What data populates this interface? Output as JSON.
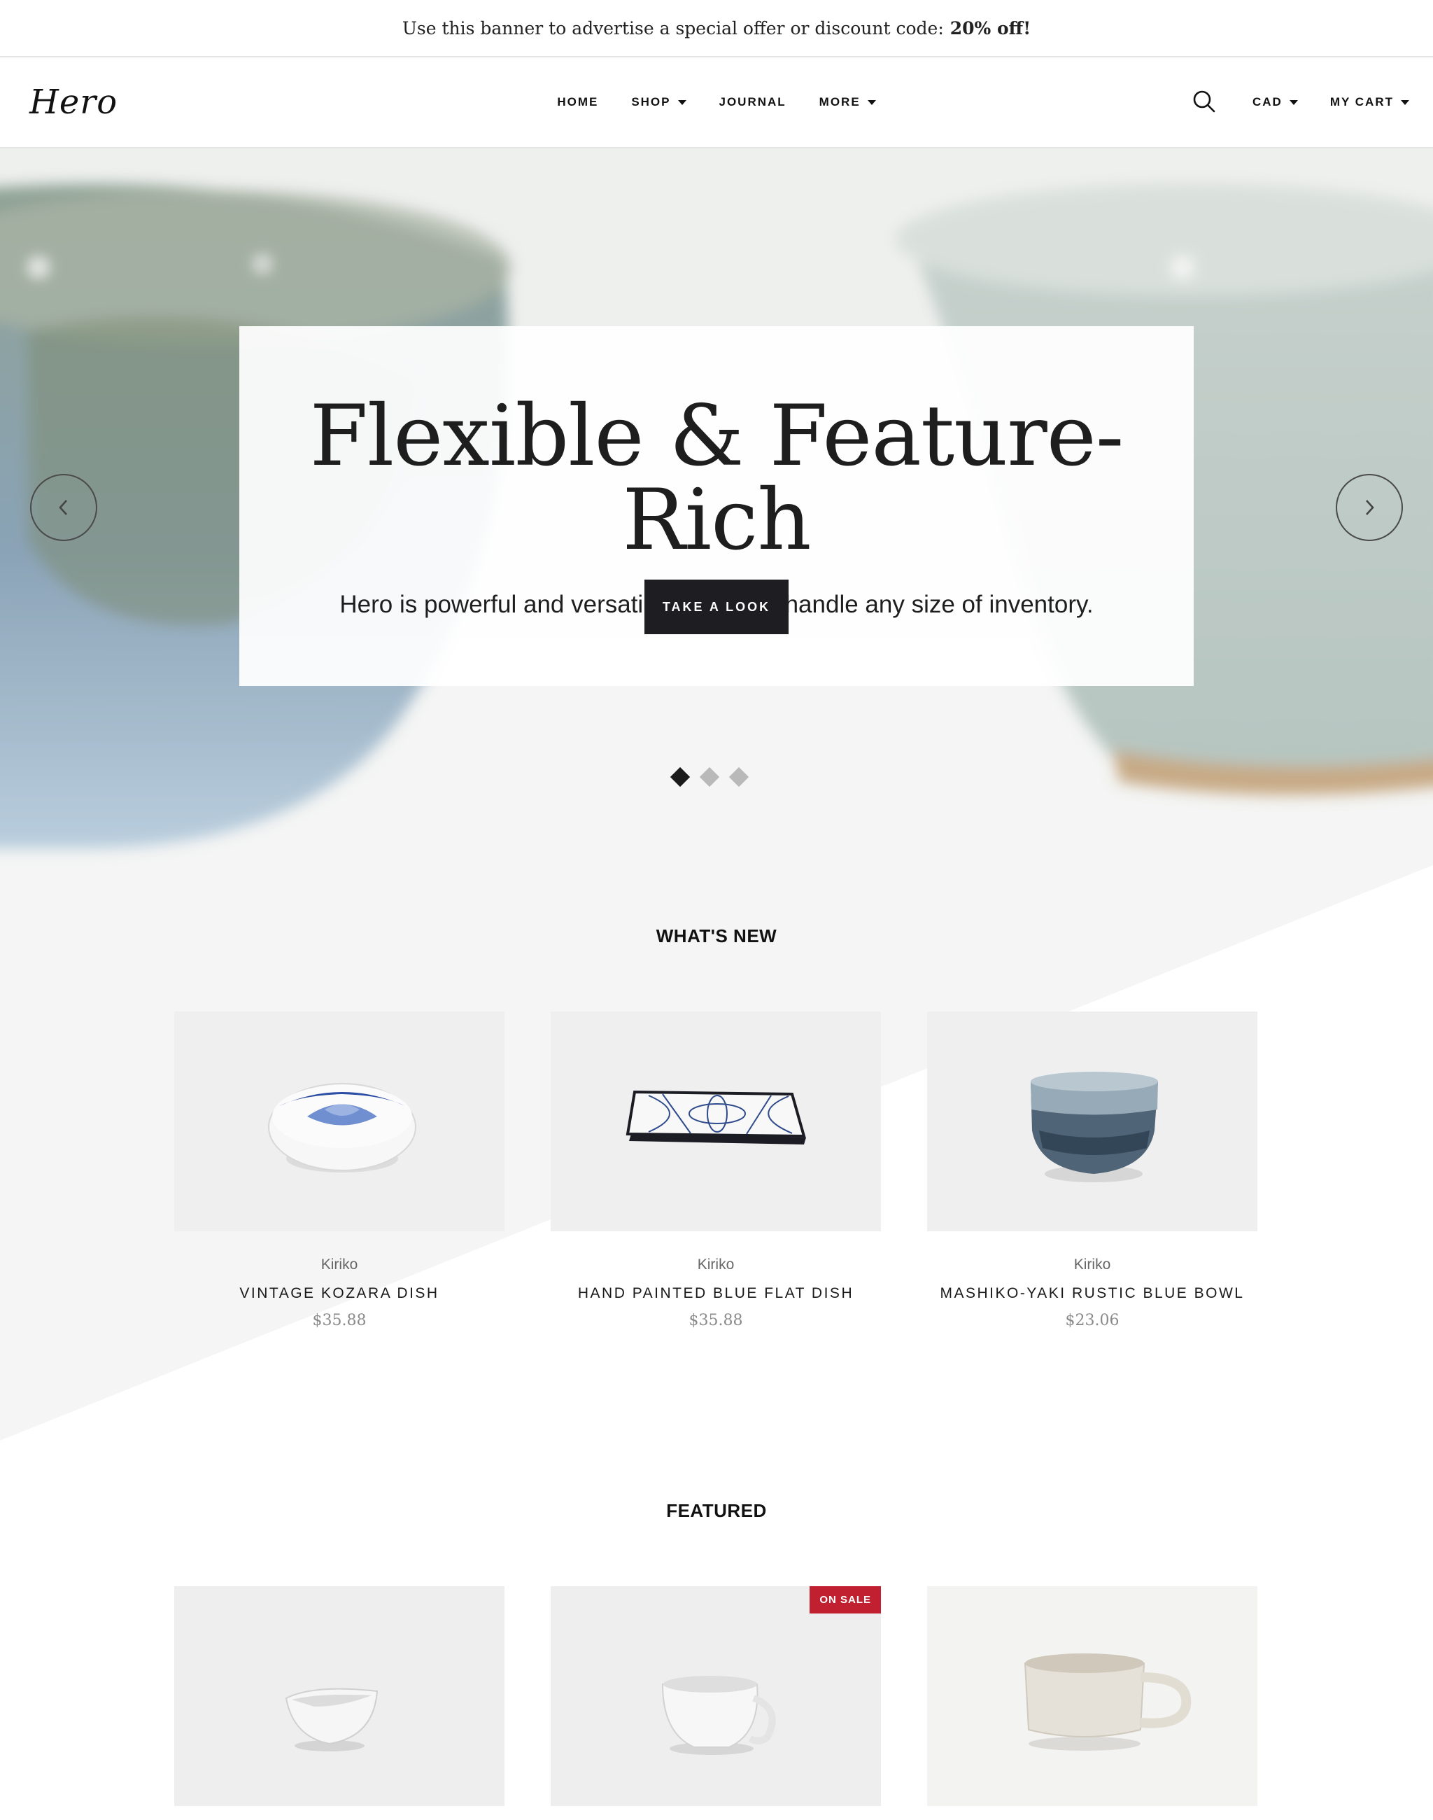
{
  "banner": {
    "text": "Use this banner to advertise a special offer or discount code:",
    "highlight": "20% off!"
  },
  "header": {
    "logo": "Hero",
    "nav": [
      {
        "label": "HOME",
        "dropdown": false
      },
      {
        "label": "SHOP",
        "dropdown": true
      },
      {
        "label": "JOURNAL",
        "dropdown": false
      },
      {
        "label": "MORE",
        "dropdown": true
      }
    ],
    "search_icon": "search-icon",
    "currency": "CAD",
    "cart": "MY CART"
  },
  "hero": {
    "title": "Flexible & Feature-Rich",
    "subtitle": "Hero is powerful and versatile enough to handle any size of inventory.",
    "button": "TAKE A LOOK",
    "slides_total": 3,
    "active_slide": 1
  },
  "whats_new": {
    "title": "WHAT'S NEW",
    "products": [
      {
        "vendor": "Kiriko",
        "name": "VINTAGE KOZARA DISH",
        "price": "$35.88"
      },
      {
        "vendor": "Kiriko",
        "name": "HAND PAINTED BLUE FLAT DISH",
        "price": "$35.88"
      },
      {
        "vendor": "Kiriko",
        "name": "MASHIKO-YAKI RUSTIC BLUE BOWL",
        "price": "$23.06"
      }
    ]
  },
  "featured": {
    "title": "FEATURED",
    "products": [
      {
        "badge": ""
      },
      {
        "badge": "ON SALE"
      },
      {
        "badge": ""
      }
    ]
  },
  "colors": {
    "button_dark": "#1d1d22",
    "sale_badge": "#c0202f",
    "price_gray": "#8a8a8a"
  }
}
